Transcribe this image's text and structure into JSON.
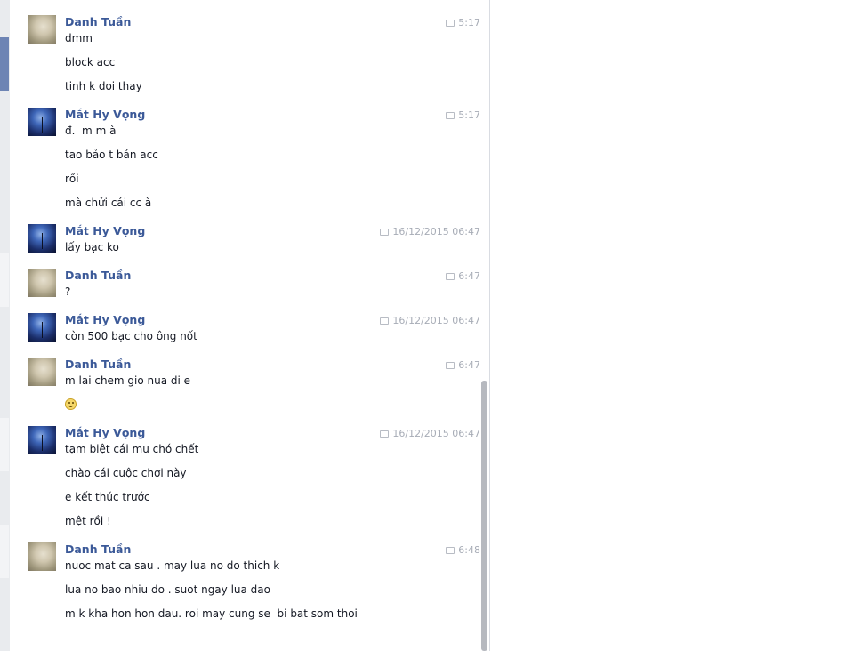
{
  "conversation": {
    "groups": [
      {
        "sender": "Danh Tuần",
        "avatar": "danh",
        "time": "5:17",
        "messages": [
          "dmm",
          "block acc",
          "tinh k doi thay"
        ]
      },
      {
        "sender": "Mắt Hy Vọng",
        "avatar": "mat",
        "time": "5:17",
        "messages": [
          "đ.  m m à",
          "tao bảo t bán acc",
          "rồi",
          "mà chửi cái cc à"
        ]
      },
      {
        "sender": "Mắt Hy Vọng",
        "avatar": "mat",
        "time": "16/12/2015 06:47",
        "messages": [
          "lấy bạc ko"
        ]
      },
      {
        "sender": "Danh Tuần",
        "avatar": "danh",
        "time": "6:47",
        "messages": [
          "?"
        ]
      },
      {
        "sender": "Mắt Hy Vọng",
        "avatar": "mat",
        "time": "16/12/2015 06:47",
        "messages": [
          "còn 500 bạc cho ông nốt"
        ]
      },
      {
        "sender": "Danh Tuần",
        "avatar": "danh",
        "time": "6:47",
        "messages": [
          "m lai chem gio nua di e"
        ],
        "emoji": "smiley-emoji"
      },
      {
        "sender": "Mắt Hy Vọng",
        "avatar": "mat",
        "time": "16/12/2015 06:47",
        "messages": [
          "tạm biệt cái mu chó chết",
          "chào cái cuộc chơi này",
          "e kết thúc trước",
          "mệt rồi !"
        ]
      },
      {
        "sender": "Danh Tuần",
        "avatar": "danh",
        "time": "6:48",
        "messages": [
          "nuoc mat ca sau . may lua no do thich k",
          "lua no bao nhiu do . suot ngay lua dao",
          "m k kha hon hon dau. roi may cung se  bi bat som thoi"
        ]
      }
    ]
  },
  "colors": {
    "sender_name": "#3b5998",
    "timestamp": "#a7acb6",
    "message_text": "#141823",
    "scrollbar": "#b6b9bf"
  }
}
